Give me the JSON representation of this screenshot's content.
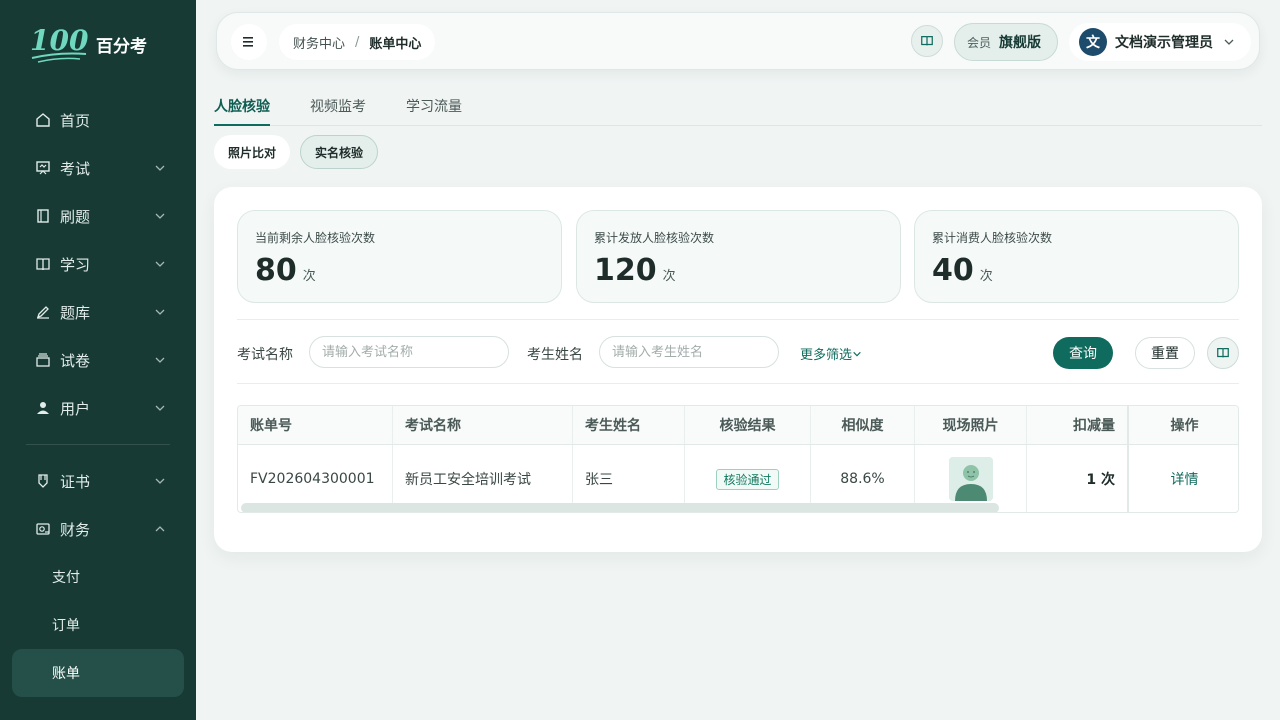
{
  "brand": {
    "logo_text": "100",
    "name": "百分考"
  },
  "sidebar": {
    "items": [
      {
        "label": "首页",
        "icon": "home-icon",
        "chevron": ""
      },
      {
        "label": "考试",
        "icon": "presentation-icon",
        "chevron": "down"
      },
      {
        "label": "刷题",
        "icon": "notebook-icon",
        "chevron": "down"
      },
      {
        "label": "学习",
        "icon": "book-open-icon",
        "chevron": "down"
      },
      {
        "label": "题库",
        "icon": "pen-icon",
        "chevron": "down"
      },
      {
        "label": "试卷",
        "icon": "stack-icon",
        "chevron": "down"
      },
      {
        "label": "用户",
        "icon": "user-icon",
        "chevron": "down"
      },
      {
        "label": "证书",
        "icon": "certificate-icon",
        "chevron": "down"
      },
      {
        "label": "财务",
        "icon": "wallet-icon",
        "chevron": "up"
      }
    ],
    "finance_sub": [
      {
        "label": "支付",
        "active": false
      },
      {
        "label": "订单",
        "active": false
      },
      {
        "label": "账单",
        "active": true
      }
    ]
  },
  "header": {
    "breadcrumb": {
      "parent": "财务中心",
      "separator": "/",
      "current": "账单中心"
    },
    "member": {
      "prefix": "会员",
      "level": "旗舰版"
    },
    "user": {
      "avatar_letter": "文",
      "name": "文档演示管理员"
    }
  },
  "tabs": [
    {
      "label": "人脸核验",
      "active": true
    },
    {
      "label": "视频监考",
      "active": false
    },
    {
      "label": "学习流量",
      "active": false
    }
  ],
  "subtabs": [
    {
      "label": "照片比对",
      "active": false
    },
    {
      "label": "实名核验",
      "active": true
    }
  ],
  "stats": [
    {
      "title": "当前剩余人脸核验次数",
      "value": "80",
      "unit": "次"
    },
    {
      "title": "累计发放人脸核验次数",
      "value": "120",
      "unit": "次"
    },
    {
      "title": "累计消费人脸核验次数",
      "value": "40",
      "unit": "次"
    }
  ],
  "filters": {
    "exam_label": "考试名称",
    "exam_placeholder": "请输入考试名称",
    "name_label": "考生姓名",
    "name_placeholder": "请输入考生姓名",
    "more": "更多筛选",
    "query": "查询",
    "reset": "重置"
  },
  "table": {
    "columns": [
      "账单号",
      "考试名称",
      "考生姓名",
      "核验结果",
      "相似度",
      "现场照片",
      "扣减量",
      "操作"
    ],
    "rows": [
      {
        "bill_no": "FV202604300001",
        "exam": "新员工安全培训考试",
        "name": "张三",
        "result": "核验通过",
        "similarity": "88.6%",
        "deduct": "1 次",
        "action": "详情"
      }
    ]
  },
  "colors": {
    "sidebar": "#173a35",
    "accent": "#0f6b5d",
    "success": "#12795f"
  }
}
